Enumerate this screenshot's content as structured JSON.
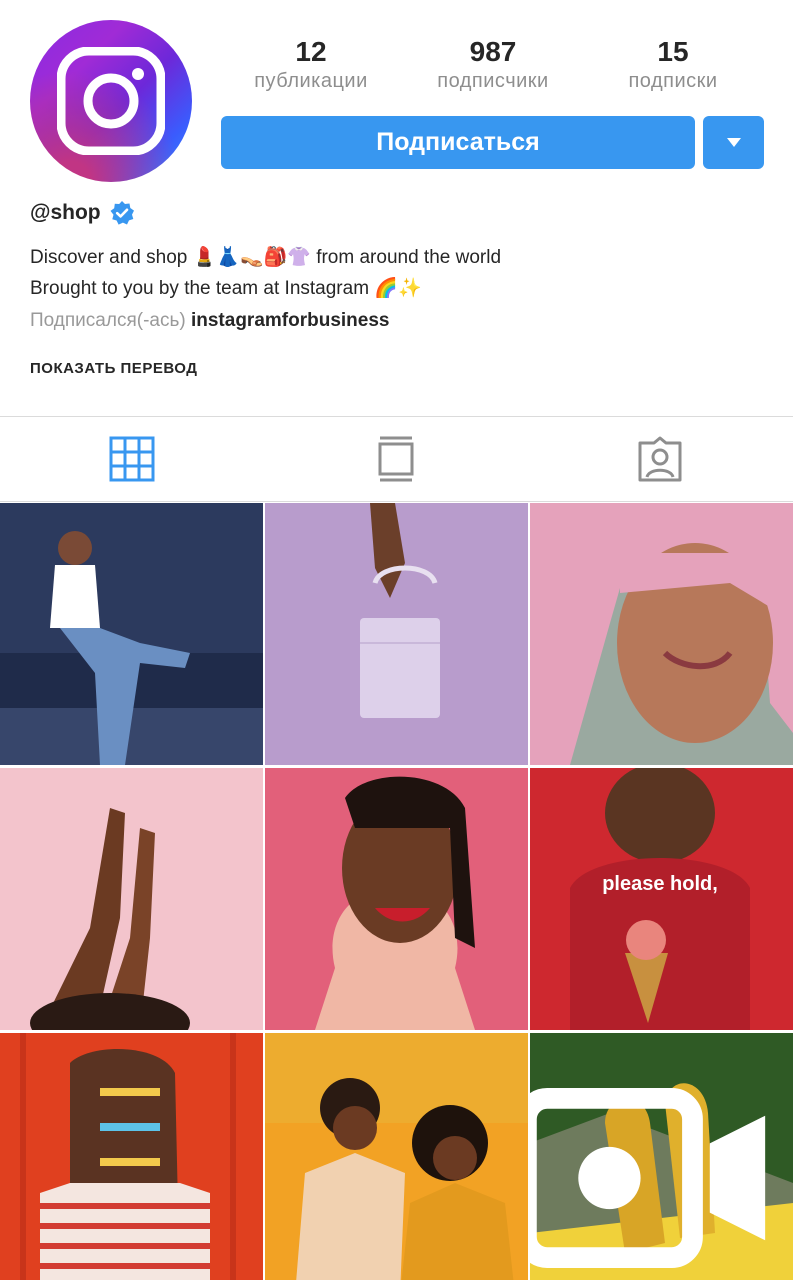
{
  "profile": {
    "username": "@shop",
    "verified": true,
    "stats": {
      "posts_count": "12",
      "posts_label": "публикации",
      "followers_count": "987",
      "followers_label": "подписчики",
      "following_count": "15",
      "following_label": "подписки"
    },
    "bio_line1": "Discover and shop 💄👗👡🎒👚 from around the world",
    "bio_line2": "Brought to you by the team at Instagram 🌈✨",
    "followed_by_prefix": "Подписался(-ась)",
    "followed_by_account": "instagramforbusiness",
    "translate_label": "ПОКАЗАТЬ ПЕРЕВОД"
  },
  "actions": {
    "follow_label": "Подписаться",
    "accent_color": "#3897f0"
  },
  "tabs": [
    {
      "icon": "grid-icon",
      "active": true
    },
    {
      "icon": "feed-icon",
      "active": false
    },
    {
      "icon": "tagged-icon",
      "active": false
    }
  ],
  "posts": [
    {
      "subject": "woman in jeans on blue wall",
      "bg": "#2c3a5e"
    },
    {
      "subject": "lilac handbag on beads",
      "bg": "#b89ccc"
    },
    {
      "subject": "pink hair woman winking",
      "bg": "#d9a3b5"
    },
    {
      "subject": "hands on pink background",
      "bg": "#f3c4cc"
    },
    {
      "subject": "smiling woman red lips",
      "bg": "#e2607a"
    },
    {
      "subject": "please hold sweatshirt ice cream",
      "bg": "#c8242f",
      "shirt_text": "please hold,"
    },
    {
      "subject": "hair clips braid",
      "bg": "#e0401f"
    },
    {
      "subject": "two women orange background",
      "bg": "#f2a224"
    },
    {
      "subject": "yellow shoes plants",
      "bg": "#3e6b2f",
      "video": true
    }
  ]
}
